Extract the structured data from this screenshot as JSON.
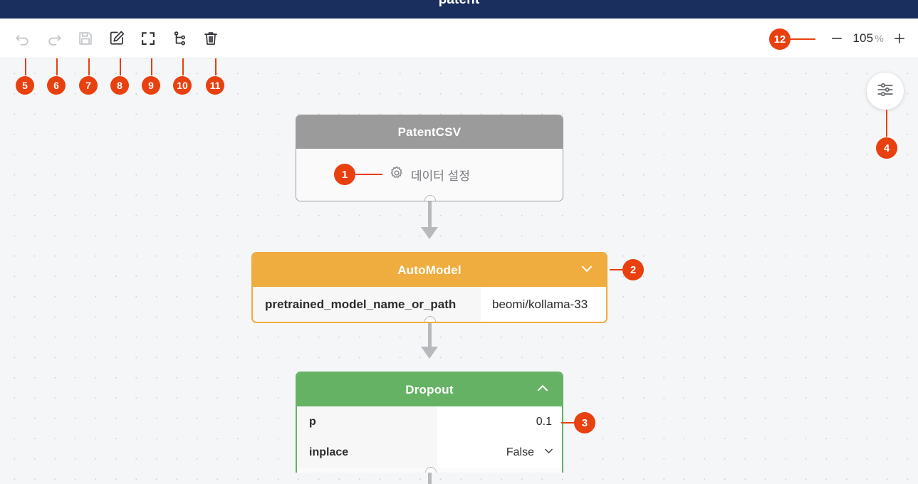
{
  "window": {
    "title": "patent"
  },
  "toolbar": {
    "buttons": [
      {
        "id": "undo",
        "icon": "undo-icon",
        "label": "Undo",
        "enabled": false
      },
      {
        "id": "redo",
        "icon": "redo-icon",
        "label": "Redo",
        "enabled": false
      },
      {
        "id": "save",
        "icon": "save-icon",
        "label": "Save",
        "enabled": false
      },
      {
        "id": "edit",
        "icon": "edit-icon",
        "label": "Edit",
        "enabled": true
      },
      {
        "id": "fit-view",
        "icon": "fullscreen-icon",
        "label": "Fit view",
        "enabled": true
      },
      {
        "id": "branch",
        "icon": "git-branch-icon",
        "label": "Branch",
        "enabled": true
      },
      {
        "id": "delete",
        "icon": "trash-icon",
        "label": "Delete",
        "enabled": true
      }
    ]
  },
  "zoom": {
    "minus_label": "−",
    "plus_label": "+",
    "value": "105",
    "unit": "%"
  },
  "fab": {
    "icon": "sliders-icon",
    "label": "Settings"
  },
  "nodes": [
    {
      "id": "patentcsv",
      "title": "PatentCSV",
      "header_color": "#9b9b9b",
      "collapse_icon": "none",
      "action_label": "데이터 설정",
      "action_icon": "gear-icon"
    },
    {
      "id": "automodel",
      "title": "AutoModel",
      "header_color": "#f0ad3f",
      "collapse_icon": "chevron-down-icon",
      "params": [
        {
          "name": "pretrained_model_name_or_path",
          "value": "beomi/kollama-33",
          "type": "text"
        }
      ]
    },
    {
      "id": "dropout",
      "title": "Dropout",
      "header_color": "#65b265",
      "collapse_icon": "chevron-up-icon",
      "params": [
        {
          "name": "p",
          "value": "0.1",
          "type": "text"
        },
        {
          "name": "inplace",
          "value": "False",
          "type": "select"
        }
      ]
    }
  ],
  "annotations": [
    {
      "id": "1",
      "target": "patentcsv-data-settings"
    },
    {
      "id": "2",
      "target": "automodel-collapse-chevron"
    },
    {
      "id": "3",
      "target": "dropout-p-value"
    },
    {
      "id": "4",
      "target": "settings-fab"
    },
    {
      "id": "5",
      "target": "toolbar-undo"
    },
    {
      "id": "6",
      "target": "toolbar-redo"
    },
    {
      "id": "7",
      "target": "toolbar-save"
    },
    {
      "id": "8",
      "target": "toolbar-edit"
    },
    {
      "id": "9",
      "target": "toolbar-fit-view"
    },
    {
      "id": "10",
      "target": "toolbar-branch"
    },
    {
      "id": "11",
      "target": "toolbar-delete"
    },
    {
      "id": "12",
      "target": "zoom-control"
    }
  ],
  "colors": {
    "header_bg": "#1a2f5e",
    "accent_badge": "#e8400e",
    "canvas_bg": "#f5f6f8",
    "node_gray": "#9b9b9b",
    "node_orange": "#f0ad3f",
    "node_green": "#65b265"
  }
}
